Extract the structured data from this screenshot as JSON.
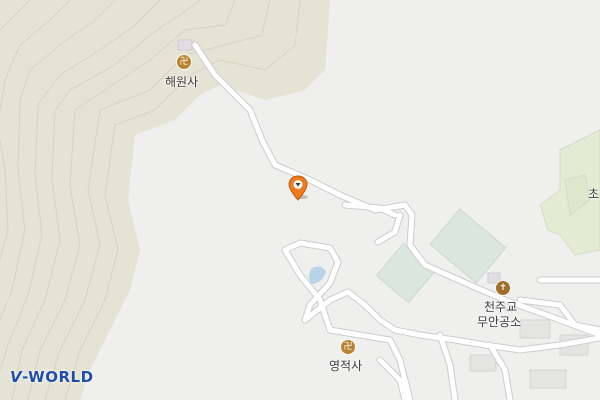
{
  "map": {
    "places": [
      {
        "key": "haewonsa",
        "label": "해원사",
        "icon": "buddhist-temple-icon",
        "glyph": "卍"
      },
      {
        "key": "yeongjeoksa",
        "label": "영적사",
        "icon": "buddhist-temple-icon",
        "glyph": "卍"
      },
      {
        "key": "catholic",
        "label_line1": "천주교",
        "label_line2": "무안공소",
        "icon": "catholic-church-icon",
        "glyph": "✝"
      },
      {
        "key": "edge",
        "label": "초",
        "icon": "school-label"
      }
    ],
    "marker": {
      "icon": "location-pin-icon",
      "color": "#ee7a1b"
    }
  },
  "brand": {
    "logo_v": "V",
    "logo_text": "-WORLD"
  },
  "colors": {
    "background": "#efefee",
    "terrain": "#e6e4d5",
    "contour": "#d8d6c6",
    "park": "#e3ecd6",
    "road_outline": "#cfcfcf",
    "road": "#ffffff",
    "field": "#dde8df",
    "logo": "#1f4ea8"
  }
}
